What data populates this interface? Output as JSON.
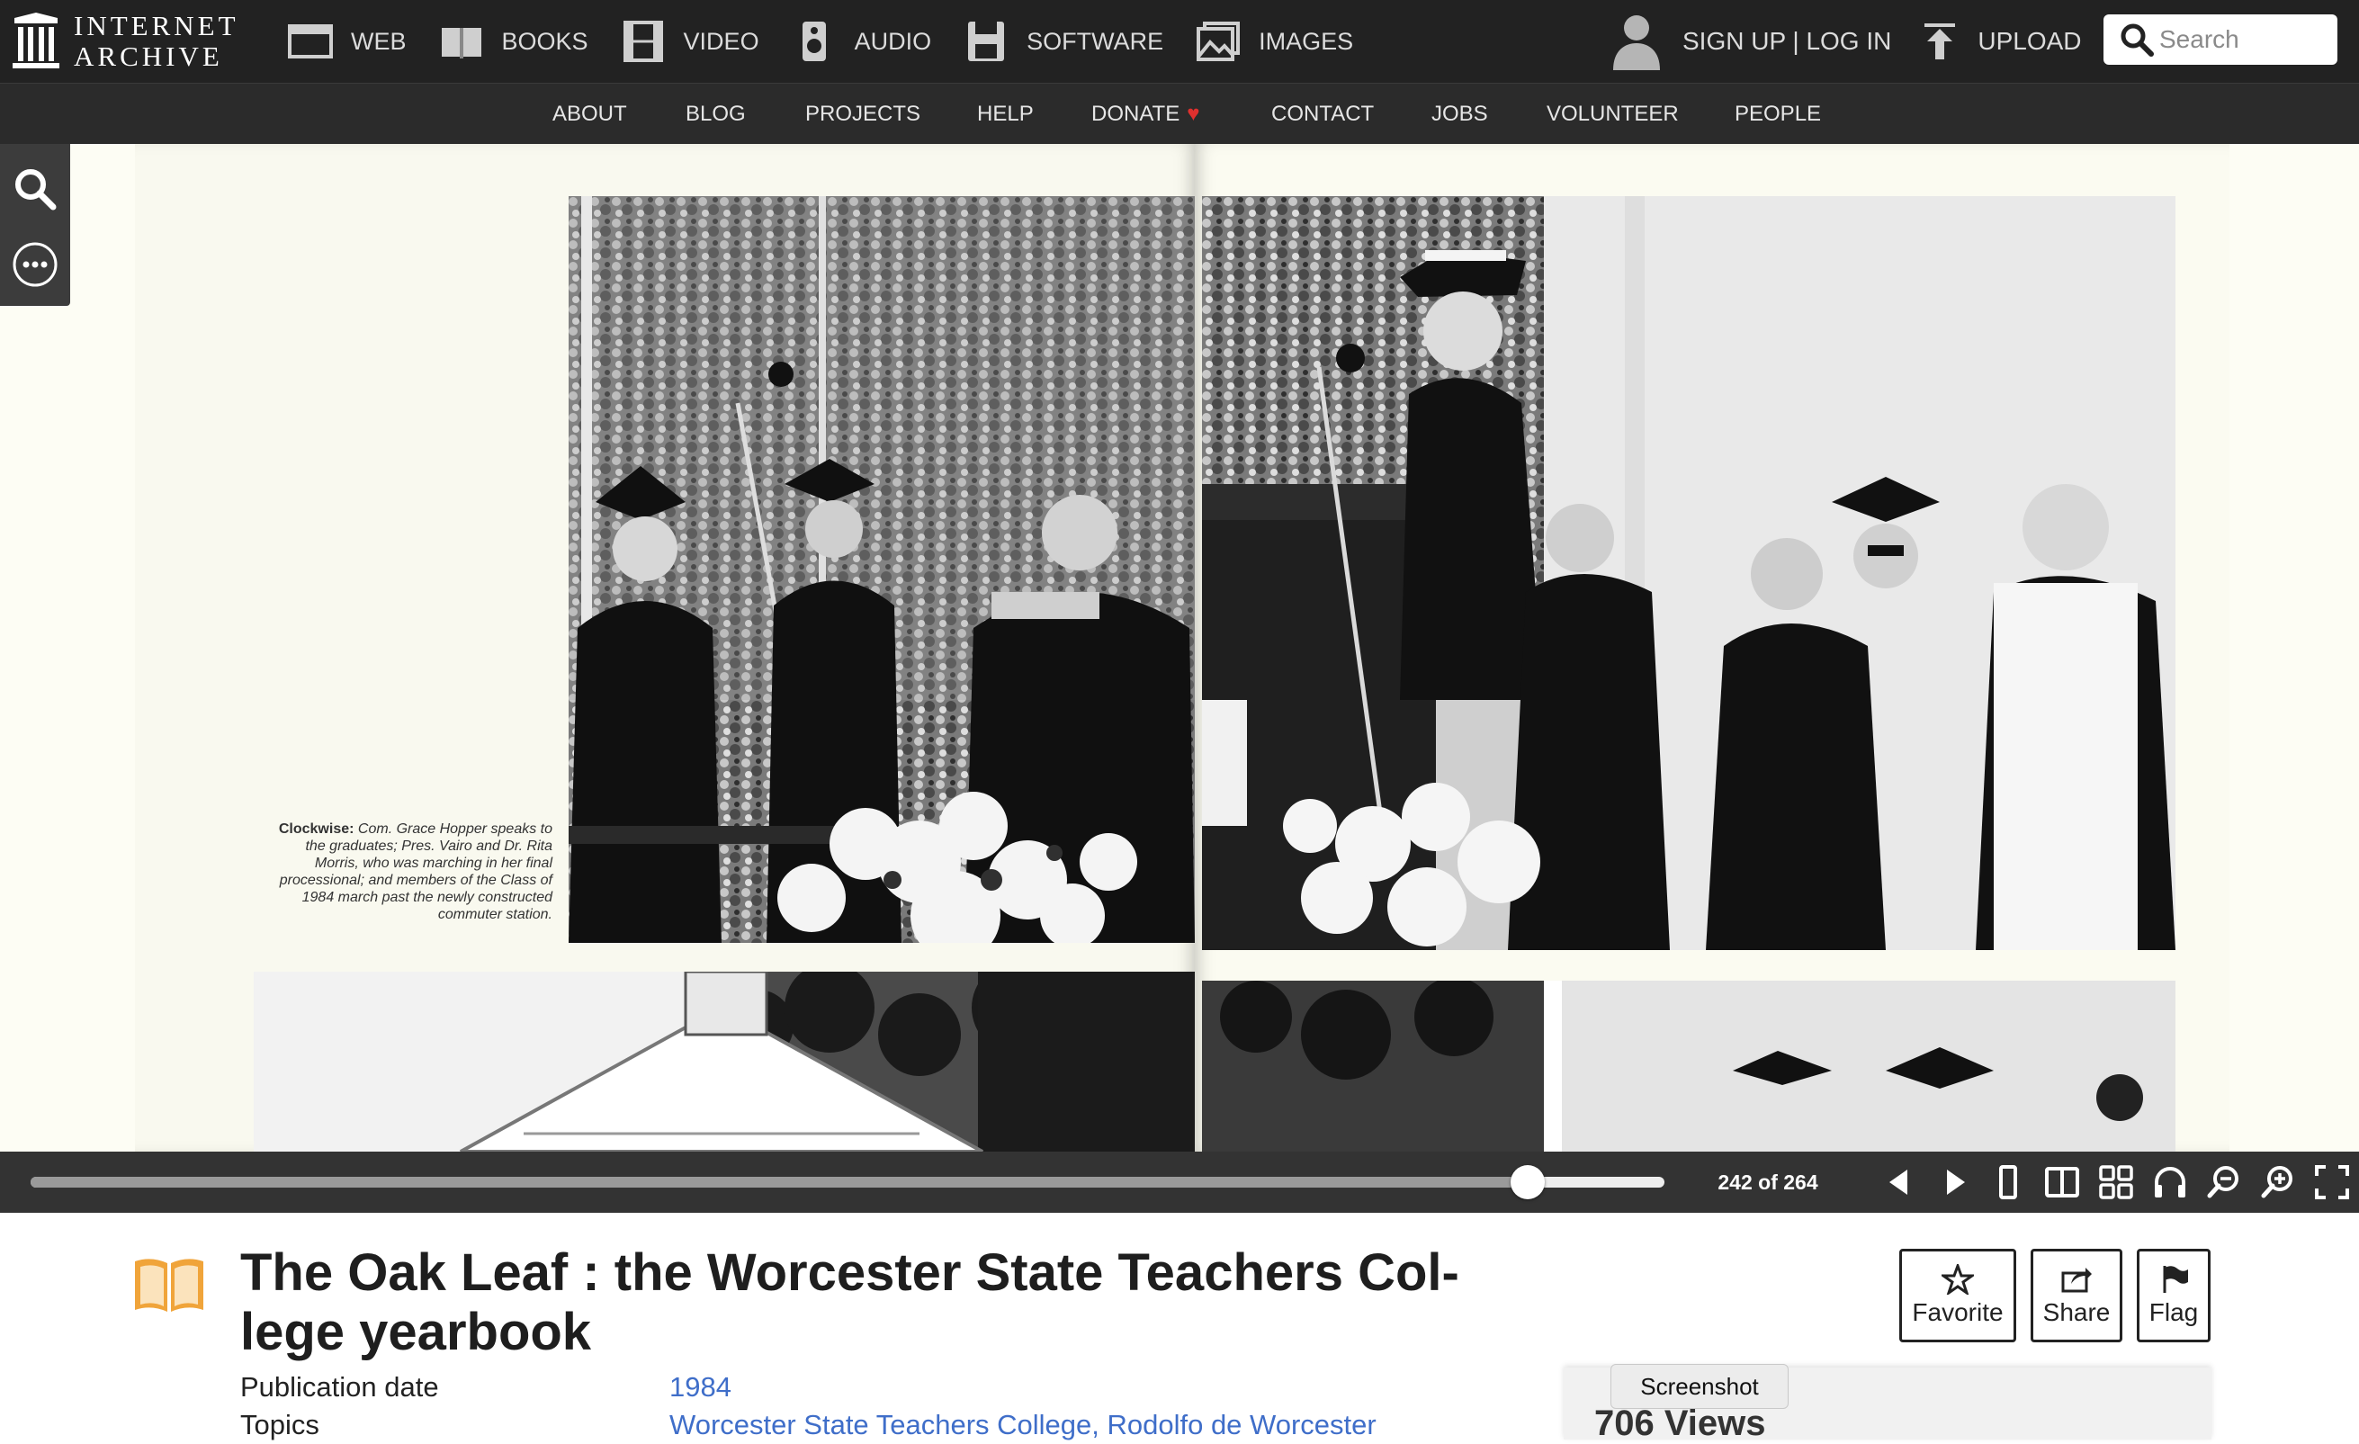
{
  "header": {
    "logo_line1": "INTERNET",
    "logo_line2": "ARCHIVE",
    "nav": [
      {
        "label": "WEB",
        "icon": "web-icon"
      },
      {
        "label": "BOOKS",
        "icon": "books-icon"
      },
      {
        "label": "VIDEO",
        "icon": "video-icon"
      },
      {
        "label": "AUDIO",
        "icon": "audio-icon"
      },
      {
        "label": "SOFTWARE",
        "icon": "software-icon"
      },
      {
        "label": "IMAGES",
        "icon": "images-icon"
      }
    ],
    "signup_label": "SIGN UP | LOG IN",
    "upload_label": "UPLOAD",
    "search_placeholder": "Search"
  },
  "subnav": {
    "items": [
      "ABOUT",
      "BLOG",
      "PROJECTS",
      "HELP",
      "DONATE",
      "CONTACT",
      "JOBS",
      "VOLUNTEER",
      "PEOPLE"
    ],
    "donate_heart": "♥"
  },
  "viewer": {
    "caption_lead": "Clockwise:",
    "caption_body": "Com. Grace Hopper speaks to the graduates; Pres. Vairo and Dr. Rita Morris, who was marching in her final processional; and members of the Class of 1984 march past the newly constructed commuter station.",
    "current_page": 242,
    "total_pages": 264,
    "page_indicator": "242 of 264"
  },
  "item": {
    "title": "The Oak Leaf : the Worcester State Teachers Col-lege yearbook",
    "pub_date_label": "Publication date",
    "pub_date_value": "1984",
    "topics_label": "Topics",
    "topics_value": "Worcester State Teachers College, Rodolfo de Worcester",
    "actions": {
      "favorite": "Favorite",
      "share": "Share",
      "flag": "Flag"
    },
    "tooltip": "Screenshot",
    "partial_panel_text": "706 Views"
  },
  "colors": {
    "topbar": "#222222",
    "subnav": "#2b2b2b",
    "controlbar": "#333333",
    "link": "#3f6ec9",
    "heart": "#e0302e",
    "book_icon": "#f0a43a"
  }
}
